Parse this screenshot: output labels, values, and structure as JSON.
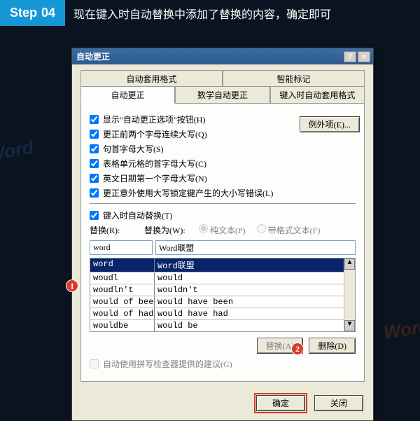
{
  "step": {
    "label": "Step",
    "number": "04",
    "desc": "现在键入时自动替换中添加了替换的内容，确定即可"
  },
  "watermark": {
    "left": "Word",
    "right": "Word"
  },
  "dialog": {
    "title": "自动更正",
    "help": "?",
    "close": "×",
    "tabs_row1": [
      "自动套用格式",
      "智能标记"
    ],
    "tabs_row2": [
      "自动更正",
      "数学自动更正",
      "键入时自动套用格式"
    ],
    "checkboxes": [
      "显示\"自动更正选项\"按钮(H)",
      "更正前两个字母连续大写(Q)",
      "句首字母大写(S)",
      "表格单元格的首字母大写(C)",
      "英文日期第一个字母大写(N)",
      "更正意外使用大写锁定键产生的大小写错误(L)"
    ],
    "exceptions_btn": "例外项(E)...",
    "replace_section": {
      "toggle": "键入时自动替换(T)",
      "replace_lbl": "替换(R):",
      "with_lbl": "替换为(W):",
      "radio_plain": "纯文本(P)",
      "radio_fmt": "带格式文本(F)",
      "input_left": "word",
      "input_right": "Word联盟"
    },
    "table": {
      "header": [
        "word",
        "Word联盟"
      ],
      "rows": [
        [
          "woudl",
          "would"
        ],
        [
          "woudln't",
          "wouldn't"
        ],
        [
          "would of been",
          "would have been"
        ],
        [
          "would of had",
          "would have had"
        ],
        [
          "wouldbe",
          "would be"
        ]
      ]
    },
    "btns": {
      "replace": "替换(A)",
      "delete": "删除(D)"
    },
    "spellcheck": "自动使用拼写检查器提供的建议(G)",
    "final": {
      "ok": "确定",
      "cancel": "关闭"
    }
  },
  "annot": {
    "1": "1",
    "2": "2"
  }
}
